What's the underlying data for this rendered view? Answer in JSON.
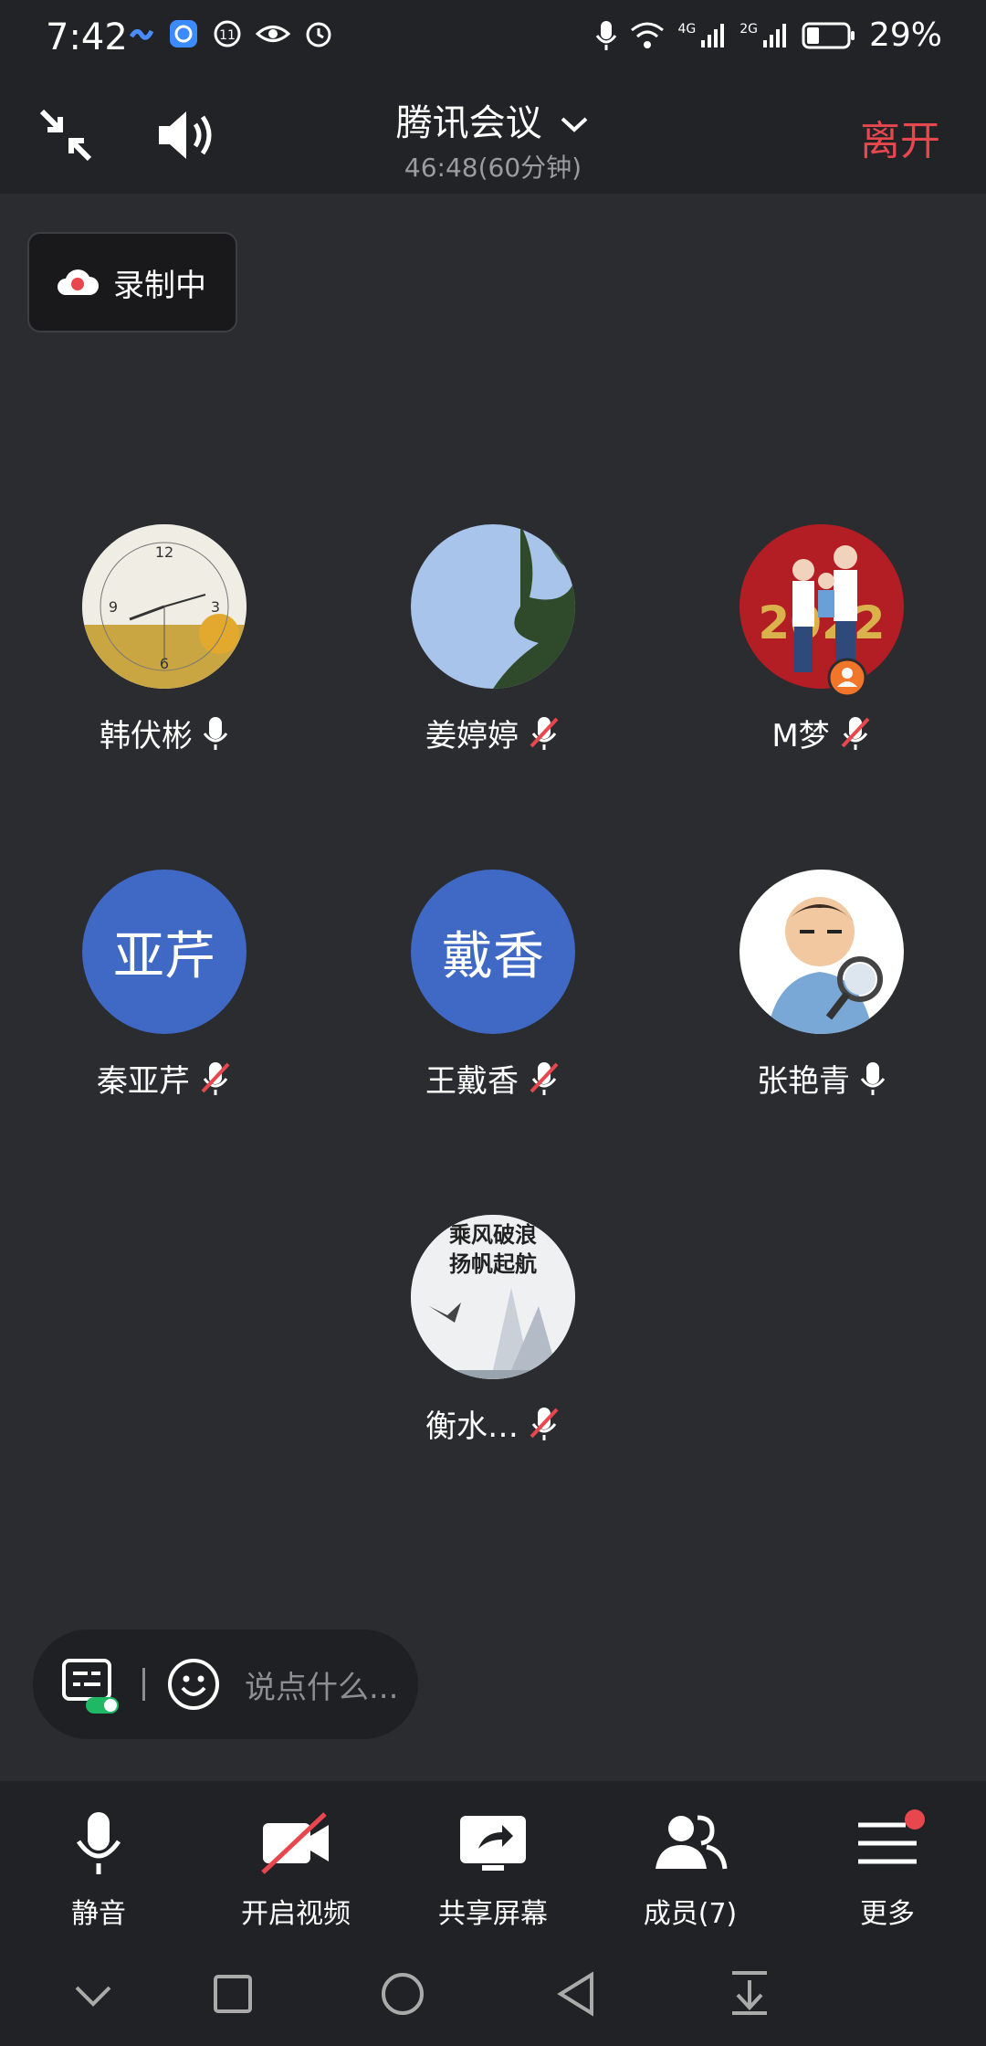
{
  "status_bar": {
    "time": "7:42",
    "battery": "29%",
    "network_4g": "4G",
    "network_2g": "2G"
  },
  "header": {
    "title": "腾讯会议",
    "timer": "46:48(60分钟)",
    "leave_label": "离开"
  },
  "recording": {
    "label": "录制中"
  },
  "participants": [
    {
      "name": "韩伏彬",
      "avatar_text": "",
      "mic": "on"
    },
    {
      "name": "姜婷婷",
      "avatar_text": "",
      "mic": "off"
    },
    {
      "name": "M梦",
      "avatar_text": "",
      "mic": "off"
    },
    {
      "name": "秦亚芹",
      "avatar_text": "亚芹",
      "mic": "off"
    },
    {
      "name": "王戴香",
      "avatar_text": "戴香",
      "mic": "off"
    },
    {
      "name": "张艳青",
      "avatar_text": "",
      "mic": "on"
    },
    {
      "name": "衡水…",
      "avatar_text": "",
      "mic": "off"
    }
  ],
  "avatar_seven_caption": [
    "乘风破浪",
    "扬帆起航"
  ],
  "chat": {
    "placeholder": "说点什么..."
  },
  "toolbar": {
    "mute": "静音",
    "video": "开启视频",
    "share": "共享屏幕",
    "members": "成员(7)",
    "more": "更多"
  },
  "colors": {
    "accent_red": "#e8474e",
    "avatar_blue": "#3f69c4",
    "background": "#2b2c30"
  }
}
